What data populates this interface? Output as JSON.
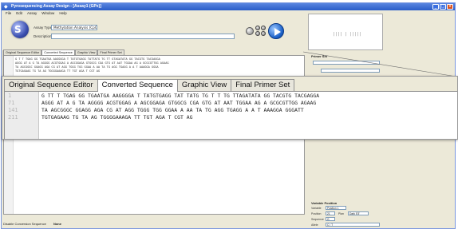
{
  "window": {
    "title": "Pyrosequencing Assay Design - [Assay1 (GPx)]",
    "menu": [
      "File",
      "Edit",
      "Assay",
      "Window",
      "Help"
    ]
  },
  "assay": {
    "type_label": "Assay Type",
    "type_value": "Methylation Analysis (CpG)",
    "description_label": "Description",
    "description_value": ""
  },
  "bg_tabs": [
    "Original Sequence Editor",
    "Converted Sequence",
    "Graphic View",
    "Final Primer Set"
  ],
  "bg_active_tab": 1,
  "bg_sequence_lines": [
    "G T T TGAG GG TGAATGA AAGGGGA T  TATGTGAGG TATTATG  TG TT GTAGATATA GG TACGTG TACGAGGA",
    "AGGG AT A G TA AGGGG ACGTGGAG  A AGCGGAGA GTGGCG CGA GTG AT AAT TGGAA AG A GCGCGTTGG AGAAG",
    "TA AGCGGGC GGAGG AGA CG AT AGG TGGG TGG GGAA A AA TA TG AGG TGAGG A A T  AAAGGA GGGA",
    "TGTGAGAAG TG TA AG TGGGGAAAGA TT TGT AGA T CGT AG"
  ],
  "right_panel": {
    "primer_set_label": "Primer Set",
    "variable_position_label": "Variable Position",
    "vp_rows": [
      {
        "label": "Variable",
        "value": "Position 1"
      },
      {
        "label": "Position",
        "value": "21",
        "extra_label": "Plan",
        "extra_value": "Dark 5'3'"
      },
      {
        "label": "Sequence",
        "value": "G"
      },
      {
        "label": "Allele",
        "value": "C / T"
      }
    ]
  },
  "status": {
    "label": "Disable Conversion Sequence",
    "value": "None"
  },
  "zoom": {
    "tabs": [
      "Original Sequence Editor",
      "Converted Sequence",
      "Graphic View",
      "Final Primer Set"
    ],
    "active_tab": 1,
    "line_numbers": [
      "1",
      "71",
      "141",
      "211"
    ],
    "lines": [
      "G TT T TGAG GG TGAATGA AAGGGGA T  TATGTGAGG TAT TATG  TG T T TG TTAGATATA GG TACGTG TACGAGGA",
      "AGGG AT A G TA AGGGG ACGTGGAG  A AGCGGAGA GTGGCG CGA GTG AT AAT TGGAA AG A GCGCGTTGG AGAAG",
      "TA AGCGGGC GGAGG AGA CG AT AGG TGGG TGG GGAA A AA TA TG AGG TGAGG A A T  AAAGGA GGGATT",
      "TGTGAGAAG TG TA AG TGGGGAAAGA TT TGT AGA T CGT AG"
    ]
  }
}
